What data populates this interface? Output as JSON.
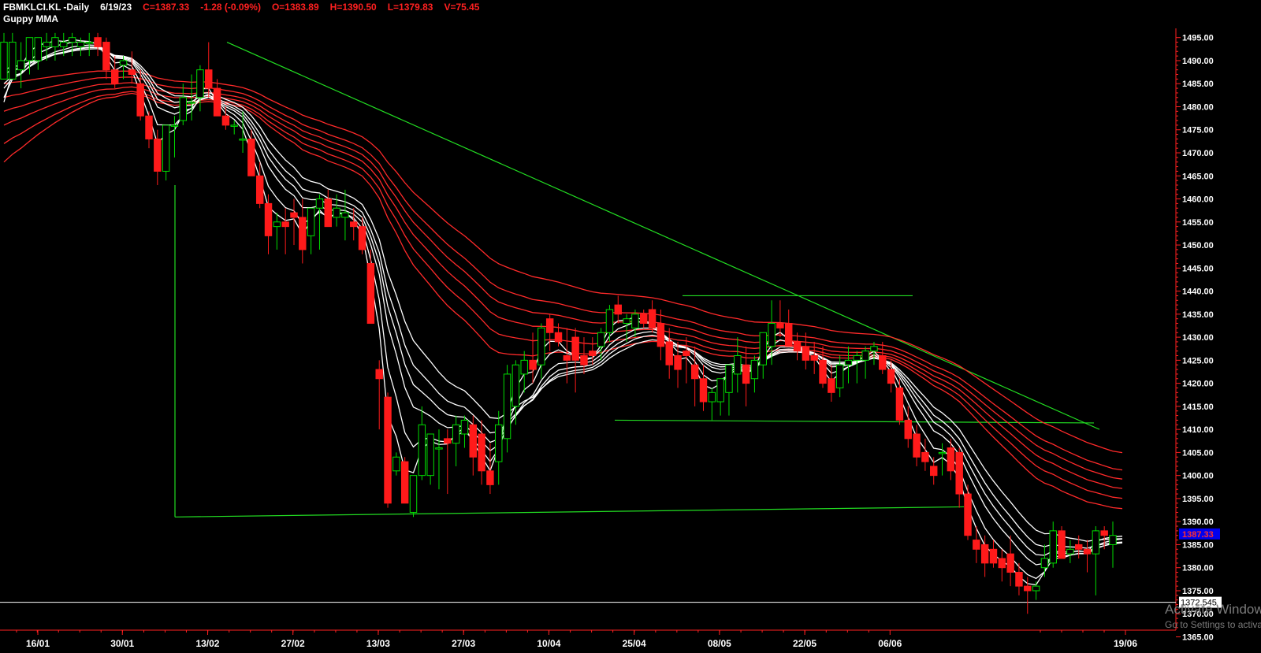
{
  "header": {
    "symbol": "FBMKLCI.KL -Daily",
    "date": "6/19/23",
    "close": "C=1387.33",
    "change": "-1.28 (-0.09%)",
    "open": "O=1383.89",
    "high": "H=1390.50",
    "low": "L=1379.83",
    "volume": "V=75.45"
  },
  "indicator_label": "Guppy MMA",
  "watermark": {
    "line1": "Activate Windows",
    "line2": "Go to Settings to activate Windows."
  },
  "colors": {
    "background": "#000000",
    "up_candle": "#00dd00",
    "down_candle": "#ff1a1a",
    "short_mma": "#ffffff",
    "long_mma": "#ff2a2a",
    "trendline": "#22dd22",
    "axis_text": "#ffffff",
    "last_price_bg": "#0000ee",
    "last_price_fg": "#ff3030"
  },
  "chart_data": {
    "type": "candlestick",
    "y_axis": {
      "range": [
        1368.5,
        1497
      ],
      "ticks": [
        "1495.00",
        "1490.00",
        "1485.00",
        "1480.00",
        "1475.00",
        "1470.00",
        "1465.00",
        "1460.00",
        "1455.00",
        "1450.00",
        "1445.00",
        "1440.00",
        "1435.00",
        "1430.00",
        "1425.00",
        "1420.00",
        "1415.00",
        "1410.00",
        "1405.00",
        "1400.00",
        "1395.00",
        "1390.00",
        "1385.00",
        "1380.00",
        "1375.00",
        "1370.00",
        "1365.00"
      ]
    },
    "x_axis": {
      "ticks": [
        "16/01",
        "30/01",
        "13/02",
        "27/02",
        "13/03",
        "27/03",
        "10/04",
        "25/04",
        "08/05",
        "22/05",
        "06/06",
        "19/06"
      ]
    },
    "last_price_label": "1387.33",
    "crosshair_price_label": "1372.545",
    "crosshair_price": 1372.5,
    "candles": [
      [
        1486,
        1496,
        1486,
        1494
      ],
      [
        1486,
        1496,
        1486,
        1494
      ],
      [
        1488,
        1494,
        1484,
        1490
      ],
      [
        1490,
        1495,
        1487,
        1495
      ],
      [
        1490,
        1495,
        1488,
        1495
      ],
      [
        1493,
        1496,
        1490,
        1494
      ],
      [
        1493,
        1496,
        1490,
        1495
      ],
      [
        1493,
        1496,
        1491,
        1494
      ],
      [
        1494,
        1496,
        1491,
        1495
      ],
      [
        1493,
        1495,
        1491,
        1494
      ],
      [
        1494,
        1496,
        1491,
        1494
      ],
      [
        1495,
        1496,
        1491,
        1493
      ],
      [
        1494,
        1495,
        1486,
        1488
      ],
      [
        1488,
        1491,
        1484,
        1485
      ],
      [
        1489,
        1491,
        1486,
        1490
      ],
      [
        1488,
        1492,
        1485,
        1487
      ],
      [
        1485,
        1488,
        1477,
        1478
      ],
      [
        1478,
        1479,
        1471,
        1473
      ],
      [
        1473,
        1475,
        1463,
        1466
      ],
      [
        1466,
        1476,
        1464,
        1476
      ],
      [
        1476,
        1478,
        1469,
        1476
      ],
      [
        1477,
        1485,
        1476,
        1482
      ],
      [
        1481,
        1487,
        1477,
        1481
      ],
      [
        1482,
        1489,
        1479,
        1488
      ],
      [
        1488,
        1494,
        1482,
        1484
      ],
      [
        1484,
        1486,
        1478,
        1478
      ],
      [
        1478,
        1480,
        1475,
        1476
      ],
      [
        1476,
        1477,
        1474,
        1476
      ],
      [
        1473,
        1479,
        1470,
        1473
      ],
      [
        1473,
        1475,
        1465,
        1465
      ],
      [
        1465,
        1468,
        1458,
        1459
      ],
      [
        1459,
        1461,
        1448,
        1452
      ],
      [
        1454,
        1457,
        1449,
        1455
      ],
      [
        1455,
        1458,
        1448,
        1454
      ],
      [
        1457,
        1460,
        1450,
        1456
      ],
      [
        1456,
        1460,
        1446,
        1449
      ],
      [
        1452,
        1458,
        1448,
        1458
      ],
      [
        1458,
        1461,
        1449,
        1460
      ],
      [
        1460,
        1462,
        1454,
        1454
      ],
      [
        1456,
        1461,
        1454,
        1458
      ],
      [
        1456,
        1462,
        1451,
        1457
      ],
      [
        1455,
        1458,
        1451,
        1454
      ],
      [
        1454,
        1456,
        1448,
        1449
      ],
      [
        1446,
        1449,
        1433,
        1433
      ],
      [
        1423,
        1425,
        1410,
        1421
      ],
      [
        1417,
        1418,
        1393,
        1394
      ],
      [
        1401,
        1405,
        1400,
        1404
      ],
      [
        1403,
        1404,
        1394,
        1394
      ],
      [
        1392,
        1396,
        1391,
        1400
      ],
      [
        1400,
        1415,
        1399,
        1411
      ],
      [
        1400,
        1407,
        1398,
        1409
      ],
      [
        1406,
        1410,
        1397,
        1406
      ],
      [
        1408,
        1410,
        1396,
        1407
      ],
      [
        1407,
        1413,
        1402,
        1411
      ],
      [
        1409,
        1413,
        1406,
        1412
      ],
      [
        1411,
        1413,
        1400,
        1404
      ],
      [
        1409,
        1412,
        1398,
        1401
      ],
      [
        1401,
        1407,
        1396,
        1398
      ],
      [
        1403,
        1414,
        1398,
        1411
      ],
      [
        1408,
        1424,
        1405,
        1422
      ],
      [
        1415,
        1425,
        1411,
        1424
      ],
      [
        1422,
        1427,
        1418,
        1425
      ],
      [
        1425,
        1431,
        1420,
        1423
      ],
      [
        1424,
        1433,
        1421,
        1432
      ],
      [
        1434,
        1435,
        1427,
        1431
      ],
      [
        1431,
        1433,
        1428,
        1429
      ],
      [
        1426,
        1432,
        1420,
        1425
      ],
      [
        1430,
        1432,
        1418,
        1425
      ],
      [
        1426,
        1430,
        1422,
        1424
      ],
      [
        1427,
        1430,
        1424,
        1426
      ],
      [
        1428,
        1432,
        1425,
        1431
      ],
      [
        1431,
        1437,
        1429,
        1436
      ],
      [
        1437,
        1439,
        1433,
        1435
      ],
      [
        1433,
        1435,
        1429,
        1434
      ],
      [
        1432,
        1436,
        1430,
        1435
      ],
      [
        1435,
        1436,
        1432,
        1433
      ],
      [
        1436,
        1438,
        1431,
        1432
      ],
      [
        1433,
        1436,
        1425,
        1428
      ],
      [
        1429,
        1432,
        1421,
        1424
      ],
      [
        1426,
        1429,
        1419,
        1423
      ],
      [
        1427,
        1430,
        1420,
        1426
      ],
      [
        1424,
        1428,
        1415,
        1421
      ],
      [
        1421,
        1424,
        1414,
        1416
      ],
      [
        1416,
        1419,
        1412,
        1418
      ],
      [
        1416,
        1419,
        1413,
        1421
      ],
      [
        1418,
        1421,
        1413,
        1424
      ],
      [
        1422,
        1430,
        1418,
        1426
      ],
      [
        1424,
        1428,
        1415,
        1420
      ],
      [
        1421,
        1426,
        1418,
        1425
      ],
      [
        1424,
        1429,
        1421,
        1431
      ],
      [
        1428,
        1438,
        1424,
        1433
      ],
      [
        1433,
        1438,
        1430,
        1432
      ],
      [
        1433,
        1436,
        1429,
        1428
      ],
      [
        1429,
        1431,
        1425,
        1427
      ],
      [
        1428,
        1431,
        1423,
        1425
      ],
      [
        1426,
        1429,
        1422,
        1425
      ],
      [
        1425,
        1428,
        1419,
        1420
      ],
      [
        1421,
        1424,
        1416,
        1418
      ],
      [
        1419,
        1426,
        1417,
        1424
      ],
      [
        1424,
        1428,
        1420,
        1425
      ],
      [
        1425,
        1427,
        1420,
        1426
      ],
      [
        1425,
        1428,
        1421,
        1427
      ],
      [
        1427,
        1429,
        1424,
        1428
      ],
      [
        1426,
        1429,
        1422,
        1423
      ],
      [
        1423,
        1425,
        1418,
        1420
      ],
      [
        1419,
        1421,
        1411,
        1412
      ],
      [
        1412,
        1415,
        1406,
        1408
      ],
      [
        1409,
        1411,
        1402,
        1404
      ],
      [
        1405,
        1408,
        1401,
        1403
      ],
      [
        1402,
        1404,
        1398,
        1400
      ],
      [
        1405,
        1407,
        1400,
        1405
      ],
      [
        1406,
        1408,
        1399,
        1401
      ],
      [
        1405,
        1406,
        1393,
        1396
      ],
      [
        1396,
        1398,
        1386,
        1387
      ],
      [
        1386,
        1389,
        1381,
        1384
      ],
      [
        1385,
        1387,
        1378,
        1381
      ],
      [
        1384,
        1386,
        1380,
        1381
      ],
      [
        1382,
        1384,
        1377,
        1380
      ],
      [
        1383,
        1387,
        1376,
        1379
      ],
      [
        1379,
        1381,
        1374,
        1376
      ],
      [
        1376,
        1378,
        1370,
        1375
      ],
      [
        1375,
        1377,
        1373,
        1376
      ],
      [
        1380,
        1385,
        1378,
        1382
      ],
      [
        1381,
        1390,
        1380,
        1388
      ],
      [
        1388,
        1389,
        1382,
        1382
      ],
      [
        1383,
        1386,
        1381,
        1384
      ],
      [
        1385,
        1387,
        1382,
        1384
      ],
      [
        1384,
        1386,
        1379,
        1383
      ],
      [
        1383,
        1389,
        1374,
        1388
      ],
      [
        1388,
        1389,
        1384,
        1387
      ],
      [
        1385,
        1390,
        1380,
        1387
      ]
    ],
    "mma_short_periods": [
      3,
      5,
      8,
      10,
      12,
      15
    ],
    "mma_long_periods": [
      30,
      35,
      40,
      45,
      50,
      60
    ],
    "trendlines": [
      {
        "name": "falling-resistance",
        "from": [
          "13/02",
          1494
        ],
        "to": [
          "06/06",
          1410
        ]
      },
      {
        "name": "upper-horizontal",
        "from": [
          "10/04",
          1439
        ],
        "to": [
          "22/05",
          1439
        ]
      },
      {
        "name": "middle-horizontal",
        "from": [
          "27/03",
          1412
        ],
        "to": [
          "06/06",
          1411
        ]
      },
      {
        "name": "lower-support",
        "from": [
          "13/02",
          1390.5
        ],
        "to": [
          "06/06",
          1393.5
        ]
      },
      {
        "name": "vertical-marker",
        "from": [
          "13/02",
          1463
        ],
        "to": [
          "13/02",
          1390.5
        ]
      }
    ]
  }
}
